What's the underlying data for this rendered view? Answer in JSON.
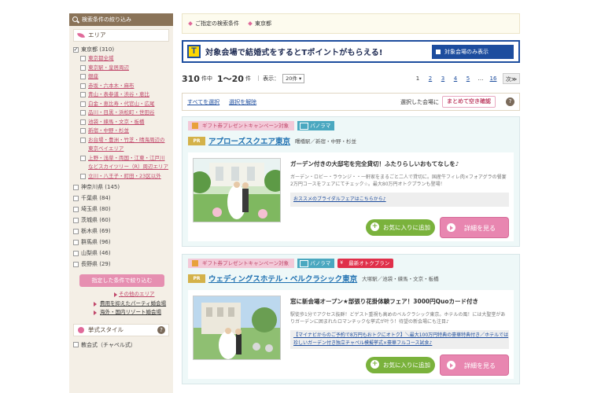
{
  "sidebar": {
    "header": "検索条件の絞り込み",
    "area_title": "エリア",
    "tokyo": "東京都 (310)",
    "tokyo_subs": [
      "東京都全域",
      "東京駅・皇居周辺",
      "銀座",
      "赤坂・六本木・麻布",
      "青山・表参道・渋谷・恵比",
      "白金・恵比寿・代官山・広尾",
      "品川・目黒・浜松町・世田谷",
      "池袋・練馬・文京・板橋",
      "新宿・中野・杉並",
      "お台場・豊洲・竹芝・晴海周辺の東京ベイエリア",
      "上野・浅草・両国・江東・江戸川などスカイツリー（R）周辺エリア",
      "立川・八王子・町田・23区以外"
    ],
    "prefs": [
      "神奈川県 (145)",
      "千葉県 (84)",
      "埼玉県 (80)",
      "茨城県 (60)",
      "栃木県 (69)",
      "群馬県 (96)",
      "山梨県 (46)",
      "長野県 (29)"
    ],
    "narrow_button": "指定した条件で絞り込む",
    "other_area": "その他のエリア",
    "party_link": "費用を抑えたパーティ婚会場",
    "overseas_link": "海外・国内リゾート婚会場",
    "style_title": "挙式スタイル",
    "style_first": "教会式（チャペル式）"
  },
  "main": {
    "cond_label": "ご指定の検索条件",
    "cond_value": "東京都",
    "tpoint": {
      "logo": "T",
      "text": "対象会場で結婚式をするとTポイントがもらえる!",
      "button": "対象会場のみ表示"
    },
    "result": {
      "count": "310",
      "count_unit": "件中",
      "range": "1〜20",
      "range_unit": "件",
      "display_label": "｜ 表示：",
      "display_value": "20件 ▾"
    },
    "pager": [
      "1",
      "2",
      "3",
      "4",
      "5",
      "…",
      "16",
      "次≫"
    ],
    "select_bar": {
      "select_all": "すべてを選択",
      "deselect": "選択を解除",
      "selected_label": "選択した会場に",
      "check_button": "まとめて空き確認",
      "help": "?"
    },
    "cards": [
      {
        "tag_gift": "ギフト券プレゼントキャンペーン対象",
        "tag_pano": "パノラマ",
        "pr": "PR",
        "name": "アプローズスクエア東京",
        "location": "曙橋駅／新宿・中野・杉並",
        "headline": "ガーデン付きの大邸宅を完全貸切！ふたりらしいおもてなしを♪",
        "text": "ガーデン・ロビー・ラウンジ・・一軒家をまるごと二人で貸切に。国産牛フィレ肉×フォアグラの餐宴2万円コースをフェアにてチェック☆。最大80万円オトクプランも登場！",
        "fair": "おススメのブライダルフェアはこちらから♪",
        "fav": "お気に入りに追加",
        "detail": "詳細を見る"
      },
      {
        "tag_gift": "ギフト券プレゼントキャンペーン対象",
        "tag_pano": "パノラマ",
        "tag_red": "最新オトクプラン",
        "pr": "PR",
        "name": "ウェディングスホテル・ベルクラシック東京",
        "location": "大塚駅／池袋・練馬・文京・板橋",
        "headline": "窓に新会場オープン★部張り花掛体験フェア！3000円Quoカード付き",
        "text": "駅徒歩1分でアクセス抜群！どゲスト重視も高めのベルクラシック東京。ホテルの風！には大聖堂がありガーデンに囲まれたロマンチックな挙式が叶う！待望の新会場にも注目♪",
        "fair": "【マイナビからのご予約で8万円もおトクにオトク】＼最大100万円特典の豪華特典付き／ホテルでは珍しいガーデン付き独立チャペル模擬挙式×豪華フルコース試食♪",
        "fav": "お気に入りに追加",
        "detail": "詳細を見る"
      }
    ]
  }
}
